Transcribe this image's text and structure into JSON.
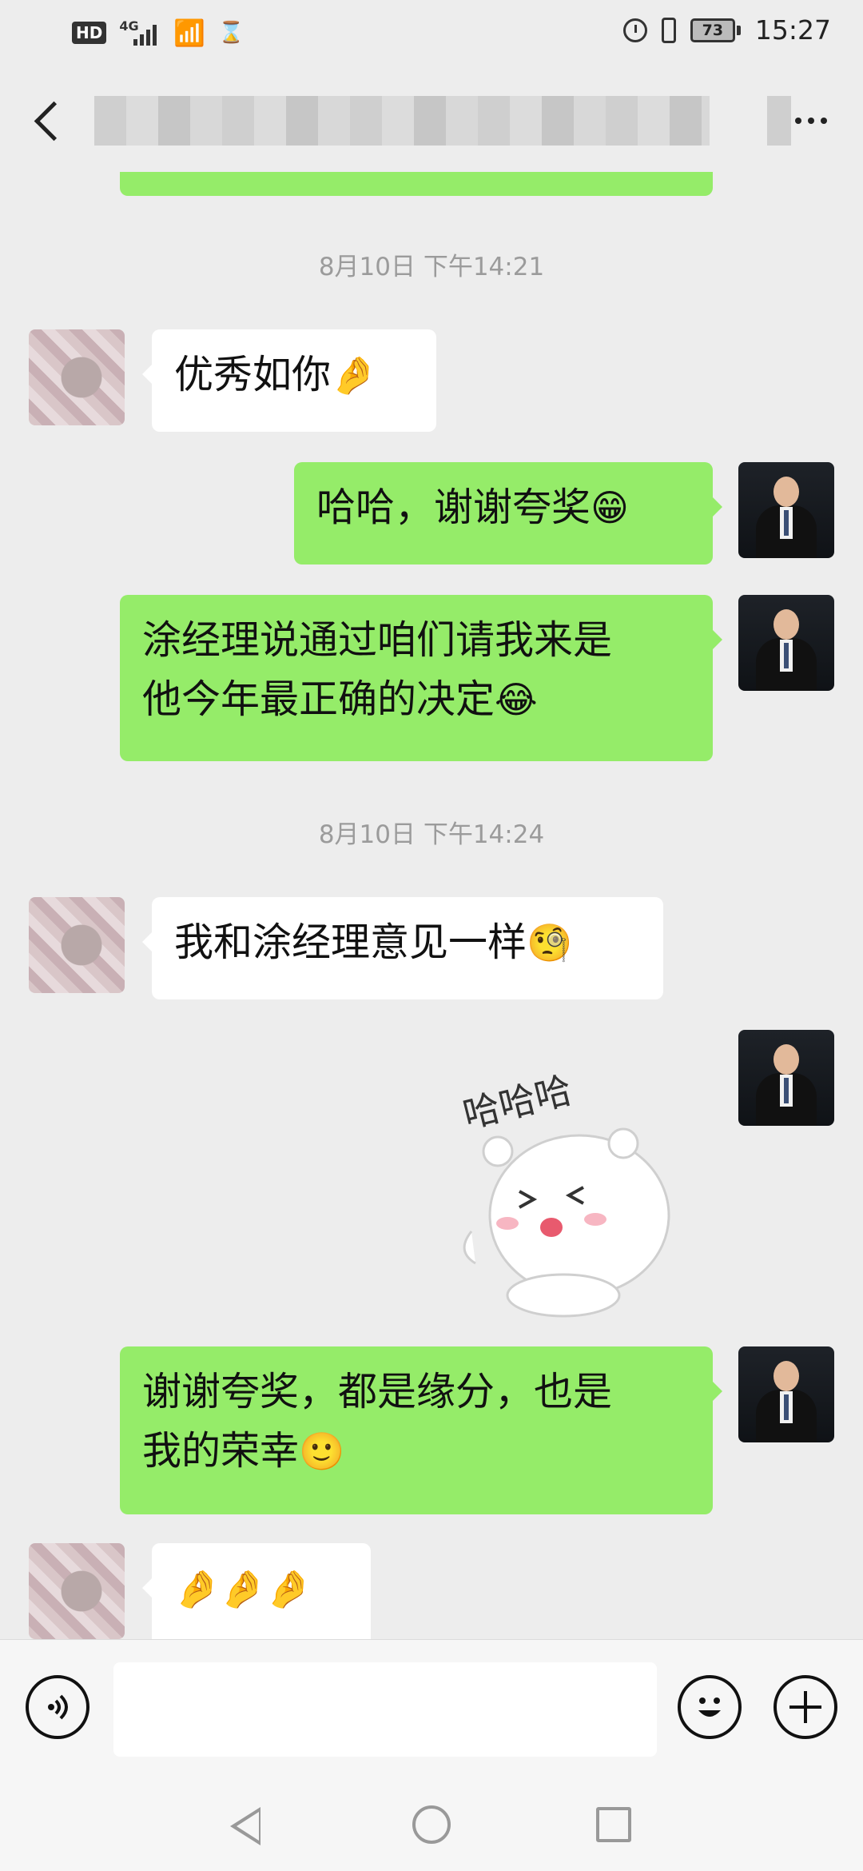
{
  "status_bar": {
    "hd_label": "HD",
    "network": "4G",
    "battery": "73",
    "time": "15:27"
  },
  "header": {
    "title": ""
  },
  "messages": [
    {
      "type": "timestamp",
      "text": "8月10日 下午14:21"
    },
    {
      "type": "text",
      "side": "left",
      "text": "优秀如你",
      "emoji": "🤌"
    },
    {
      "type": "text",
      "side": "right",
      "text": "哈哈，谢谢夸奖",
      "emoji": "😁"
    },
    {
      "type": "text",
      "side": "right",
      "text": "涂经理说通过咱们请我来是\n他今年最正确的决定",
      "emoji": "😂"
    },
    {
      "type": "timestamp",
      "text": "8月10日 下午14:24"
    },
    {
      "type": "text",
      "side": "left",
      "text": "我和涂经理意见一样",
      "emoji": "🧐"
    },
    {
      "type": "sticker",
      "side": "right",
      "text": "哈哈哈"
    },
    {
      "type": "text",
      "side": "right",
      "text": "谢谢夸奖，都是缘分，也是\n我的荣幸",
      "emoji": "🙂"
    },
    {
      "type": "text",
      "side": "left",
      "text": "",
      "emoji": "🤌🤌🤌"
    }
  ],
  "input": {
    "value": ""
  },
  "icons": {
    "voice": "voice-icon",
    "emoji": "emoji-icon",
    "plus": "plus-icon",
    "back": "back-arrow-icon",
    "more": "more-icon"
  },
  "colors": {
    "green_bubble": "#95ec69",
    "white_bubble": "#ffffff",
    "background": "#ededed"
  }
}
